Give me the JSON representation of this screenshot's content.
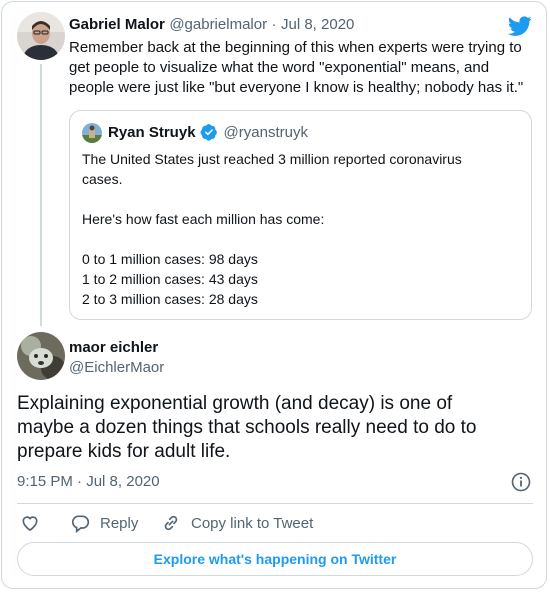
{
  "parent_tweet": {
    "author_name": "Gabriel Malor",
    "author_handle": "@gabrielmalor",
    "separator": "·",
    "date": "Jul 8, 2020",
    "text": "Remember back at the beginning of this when experts were trying to get people to visualize what the word \"exponential\" means, and people were just like \"but everyone I know is healthy; nobody has it.\"",
    "lines": [
      "Remember back at the beginning of this when experts were trying to",
      "get people to visualize what the word \"exponential\" means, and",
      "people were just like \"but everyone I know is healthy; nobody has it.\""
    ]
  },
  "quoted_tweet": {
    "author_name": "Ryan Struyk",
    "author_handle": "@ryanstruyk",
    "verified": true,
    "lines": [
      "The United States just reached 3 million reported coronavirus",
      "cases.",
      "",
      "Here's how fast each million has come:",
      "",
      "0 to 1 million cases: 98 days",
      "1 to 2 million cases: 43 days",
      "2 to 3 million cases: 28 days"
    ]
  },
  "main_tweet": {
    "author_name": "maor eichler",
    "author_handle": "@EichlerMaor",
    "lines": [
      "Explaining exponential growth (and decay) is one of",
      "maybe a dozen things that schools really need to do to",
      "prepare kids for adult life."
    ],
    "time": "9:15 PM",
    "separator": "·",
    "date": "Jul 8, 2020"
  },
  "actions": {
    "reply_label": "Reply",
    "copy_link_label": "Copy link to Tweet"
  },
  "explore_label": "Explore what's happening on Twitter",
  "colors": {
    "twitter_blue": "#1d9bf0",
    "verified_blue": "#1d9bf0",
    "border": "#cfd9de",
    "secondary_text": "#536471"
  },
  "icons": [
    "twitter-bird-icon",
    "verified-badge-icon",
    "info-icon",
    "heart-icon",
    "reply-icon",
    "link-icon"
  ]
}
